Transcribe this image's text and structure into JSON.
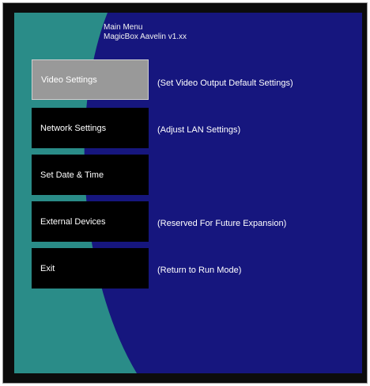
{
  "header": {
    "title": "Main Menu",
    "subtitle": "MagicBox Aavelin v1.xx"
  },
  "menu": {
    "items": [
      {
        "label": "Video Settings",
        "description": "(Set Video Output Default Settings)",
        "selected": true
      },
      {
        "label": "Network Settings",
        "description": "(Adjust LAN Settings)",
        "selected": false
      },
      {
        "label": "Set Date & Time",
        "description": "",
        "selected": false
      },
      {
        "label": "External Devices",
        "description": "(Reserved For Future Expansion)",
        "selected": false
      },
      {
        "label": "Exit",
        "description": "(Return to Run Mode)",
        "selected": false
      }
    ]
  },
  "colors": {
    "background_blue": "#16167e",
    "background_teal": "#2a8c88",
    "button_bg": "#000000",
    "button_selected_bg": "#999999",
    "text": "#ffffff"
  }
}
